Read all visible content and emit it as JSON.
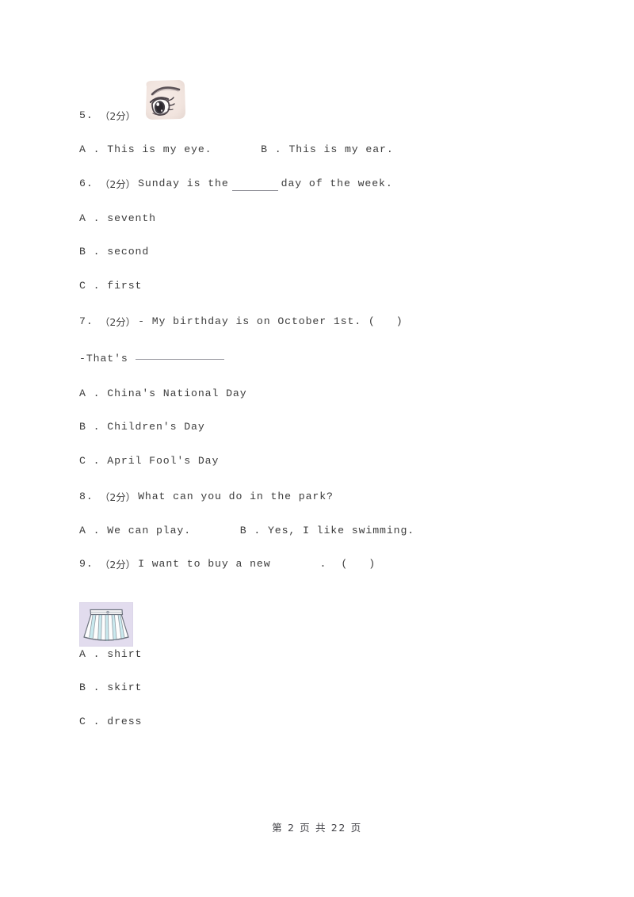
{
  "page": {
    "background_color": "#ffffff",
    "text_color": "#3c3c3c",
    "footer": "第 2 页 共 22 页"
  },
  "questions": [
    {
      "number": "5.",
      "score": "（2分）",
      "stem": "",
      "image": {
        "name": "eye-illustration",
        "alt": "cartoon eye with eyebrow",
        "background_color": "#f2e6e2",
        "outline_color": "#4a4248"
      },
      "options_inline": [
        {
          "label": "A .",
          "text": "This is my eye."
        },
        {
          "label": "B .",
          "text": "This is my ear."
        }
      ]
    },
    {
      "number": "6.",
      "score": "（2分）",
      "stem_before_blank": "Sunday is the",
      "stem_after_blank": "day of the week.",
      "options": [
        {
          "label": "A .",
          "text": "seventh"
        },
        {
          "label": "B .",
          "text": "second"
        },
        {
          "label": "C .",
          "text": "first"
        }
      ]
    },
    {
      "number": "7.",
      "score": "（2分）",
      "stem": "- My birthday is on October 1st. (",
      "stem_close": ")",
      "answer_line_prefix": "-That's",
      "options": [
        {
          "label": "A .",
          "text": "China's National Day"
        },
        {
          "label": "B .",
          "text": "Children's Day"
        },
        {
          "label": "C .",
          "text": "April Fool's Day"
        }
      ]
    },
    {
      "number": "8.",
      "score": "（2分）",
      "stem": "What can you do in the park?",
      "options_inline": [
        {
          "label": "A .",
          "text": "We can play."
        },
        {
          "label": "B .",
          "text": "Yes, I like swimming."
        }
      ]
    },
    {
      "number": "9.",
      "score": "（2分）",
      "stem_before_blank": "I want to buy a new",
      "stem_after_blank": ".",
      "stem_paren_open": "(",
      "stem_paren_close": ")",
      "image": {
        "name": "skirt-illustration",
        "alt": "pleated skirt",
        "background_color": "#e0dcee",
        "fabric_color": "#c9e9ee",
        "outline_color": "#6f7580"
      },
      "options": [
        {
          "label": "A .",
          "text": "shirt"
        },
        {
          "label": "B .",
          "text": "skirt"
        },
        {
          "label": "C .",
          "text": "dress"
        }
      ]
    }
  ]
}
